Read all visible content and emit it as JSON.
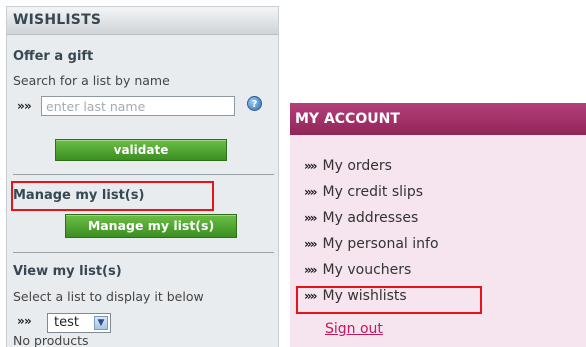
{
  "wishlists": {
    "header": "WISHLISTS",
    "offer_title": "Offer a gift",
    "search_hint": "Search for a list by name",
    "search_placeholder": "enter last name",
    "help_icon": "?",
    "validate_label": "validate",
    "manage_title": "Manage my list(s)",
    "manage_button_label": "Manage my list(s)",
    "view_title": "View my list(s)",
    "select_hint": "Select a list to display it below",
    "selected_list": "test",
    "empty_text": "No products",
    "arrow_glyph": "»",
    "select_arrow": "▼"
  },
  "account": {
    "header": "MY ACCOUNT",
    "bullet": "»",
    "items": [
      "My orders",
      "My credit slips",
      "My addresses",
      "My personal info",
      "My vouchers",
      "My wishlists"
    ],
    "sign_out": "Sign out"
  },
  "colors": {
    "account_header": "#a8336c",
    "account_bg": "#f6e4ef",
    "wishlist_bg": "#e9ecef",
    "button_green": "#4a9a2c",
    "highlight_red": "#e8141b",
    "sign_out_link": "#c2185b"
  }
}
